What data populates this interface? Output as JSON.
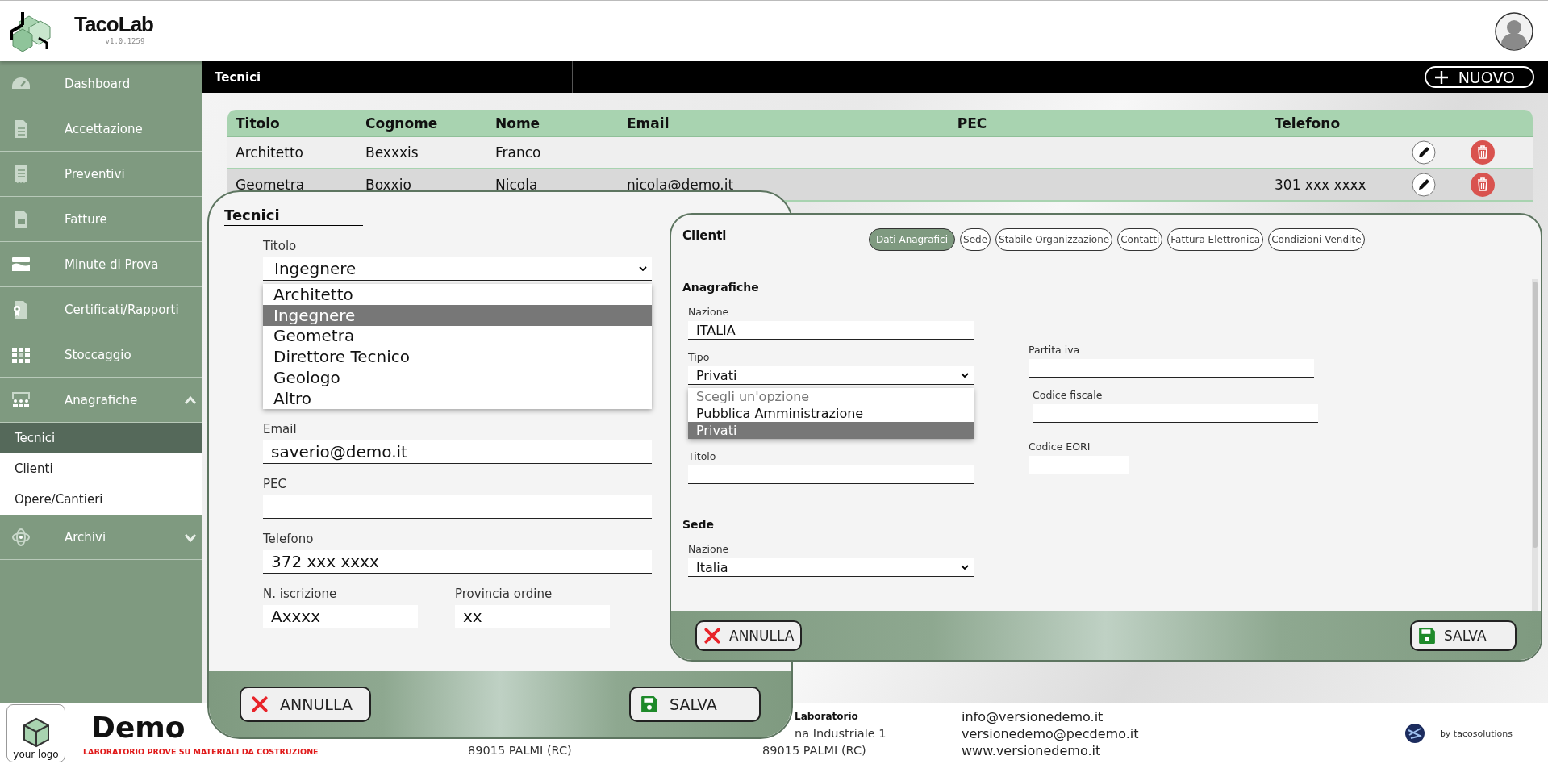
{
  "header": {
    "app_name": "TacoLab",
    "version": "v1.0.1259"
  },
  "sidebar": {
    "items": [
      {
        "label": "Dashboard"
      },
      {
        "label": "Accettazione"
      },
      {
        "label": "Preventivi"
      },
      {
        "label": "Fatture"
      },
      {
        "label": "Minute di Prova"
      },
      {
        "label": "Certificati/Rapporti"
      },
      {
        "label": "Stoccaggio"
      },
      {
        "label": "Anagrafiche",
        "expanded": true,
        "children": [
          {
            "label": "Tecnici",
            "selected": true
          },
          {
            "label": "Clienti",
            "selected": false
          },
          {
            "label": "Opere/Cantieri",
            "selected": false
          }
        ]
      },
      {
        "label": "Archivi",
        "expanded": false
      }
    ]
  },
  "toolbar": {
    "title": "Tecnici",
    "new_button": "NUOVO"
  },
  "table": {
    "columns": [
      "Titolo",
      "Cognome",
      "Nome",
      "Email",
      "PEC",
      "Telefono"
    ],
    "rows": [
      {
        "titolo": "Architetto",
        "cognome": "Bexxxis",
        "nome": "Franco"
      },
      {
        "titolo": "Geometra",
        "cognome": "Boxxio",
        "nome": "Nicola",
        "email": "nicola@demo.it",
        "telefono": "301 xxx xxxx"
      }
    ]
  },
  "tecnici_dialog": {
    "title": "Tecnici",
    "fields": [
      {
        "kind": "select",
        "label": "Titolo",
        "value": "Ingegnere",
        "options": [
          {
            "label": "Architetto",
            "selected": false
          },
          {
            "label": "Ingegnere",
            "selected": true
          },
          {
            "label": "Geometra",
            "selected": false
          },
          {
            "label": "Direttore Tecnico",
            "selected": false
          },
          {
            "label": "Geologo",
            "selected": false
          },
          {
            "label": "Altro",
            "selected": false
          }
        ]
      },
      {
        "kind": "text",
        "label": "Email",
        "value": "saverio@demo.it"
      },
      {
        "kind": "text",
        "label": "PEC"
      },
      {
        "kind": "text",
        "label": "Telefono",
        "value": "372 xxx xxxx"
      }
    ],
    "pair_fields": [
      {
        "kind": "text",
        "label": "N. iscrizione",
        "value": "Axxxx"
      },
      {
        "kind": "text",
        "label": "Provincia ordine",
        "value": "xx"
      }
    ],
    "cancel_button": "ANNULLA",
    "save_button": "SALVA"
  },
  "clienti_dialog": {
    "title": "Clienti",
    "tabs": [
      {
        "label": "Dati Anagrafici",
        "selected": true
      },
      {
        "label": "Sede",
        "selected": false
      },
      {
        "label": "Stabile Organizzazione",
        "selected": false
      },
      {
        "label": "Contatti",
        "selected": false
      },
      {
        "label": "Fattura Elettronica",
        "selected": false
      },
      {
        "label": "Condizioni Vendite",
        "selected": false
      }
    ],
    "anagrafiche": {
      "title": "Anagrafiche",
      "left_fields": [
        {
          "kind": "text",
          "label": "Nazione",
          "value": "ITALIA"
        },
        {
          "kind": "select",
          "label": "Tipo",
          "value": "Privati",
          "options": [
            {
              "label": "Scegli un'opzione",
              "selected": false,
              "disabled": true
            },
            {
              "label": "Pubblica Amministrazione",
              "selected": false,
              "disabled": false
            },
            {
              "label": "Privati",
              "selected": true,
              "disabled": false
            }
          ]
        },
        {
          "kind": "text",
          "label": "Titolo"
        }
      ],
      "right_fields": [
        {
          "kind": "text",
          "label": "Partita iva"
        },
        {
          "kind": "text",
          "label": "Codice fiscale"
        },
        {
          "kind": "text",
          "label": "Codice EORI"
        }
      ]
    },
    "sede": {
      "title": "Sede",
      "fields": [
        {
          "kind": "select",
          "label": "Nazione",
          "value": "Italia"
        }
      ]
    },
    "cancel_button": "ANNULLA",
    "save_button": "SALVA"
  },
  "footer": {
    "logo_text": "your logo",
    "company": "Demo",
    "tagline": "LABORATORIO PROVE SU MATERIALI DA COSTRUZIONE",
    "address_columns": [
      [
        {
          "kind": "line",
          "text": "89015 PALMI (RC)"
        }
      ],
      [
        {
          "kind": "title",
          "text": "Laboratorio",
          "cut": true
        },
        {
          "kind": "line",
          "text": "na Industriale 1",
          "cut": true
        },
        {
          "kind": "line",
          "text": "89015 PALMI (RC)",
          "cut": false
        }
      ]
    ],
    "contacts": [
      "info@versionedemo.it",
      "versionedemo@pecdemo.it",
      "www.versionedemo.it"
    ],
    "credit": "by tacosolutions"
  }
}
